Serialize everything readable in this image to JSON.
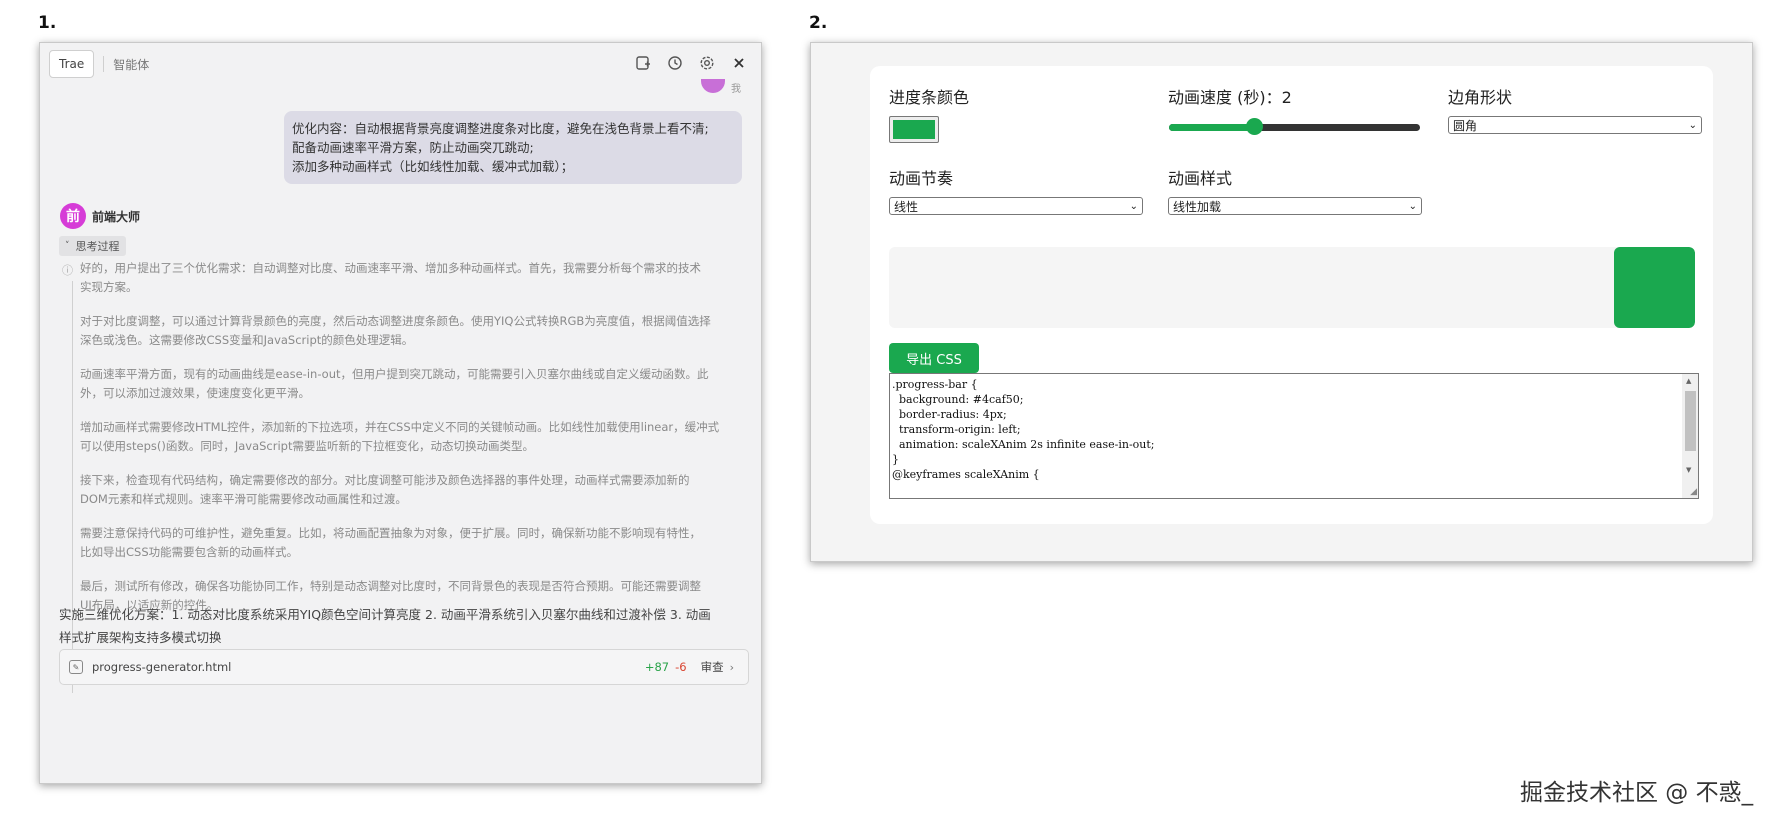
{
  "panel_numbers": {
    "left": "1.",
    "right": "2."
  },
  "left_panel": {
    "tabs": {
      "trae": "Trae",
      "agent": "智能体"
    },
    "user_peek_text": "我",
    "user_message": [
      "优化内容：自动根据背景亮度调整进度条对比度，避免在浅色背景上看不清;",
      "配备动画速率平滑方案，防止动画突兀跳动;",
      "添加多种动画样式（比如线性加载、缓冲式加载）；"
    ],
    "agent": {
      "avatar_char": "前",
      "name": "前端大师"
    },
    "thinking_toggle": "思考过程",
    "thinking_paragraphs": [
      [
        "好的，用户提出了三个优化需求：自动调整对比度、动画速率平滑、增加多种动画样式。首先，我需要分析每个需求的技术",
        "实现方案。"
      ],
      [
        "对于对比度调整，可以通过计算背景颜色的亮度，然后动态调整进度条颜色。使用YIQ公式转换RGB为亮度值，根据阈值选择",
        "深色或浅色。这需要修改CSS变量和JavaScript的颜色处理逻辑。"
      ],
      [
        "动画速率平滑方面，现有的动画曲线是ease-in-out，但用户提到突兀跳动，可能需要引入贝塞尔曲线或自定义缓动函数。此",
        "外，可以添加过渡效果，使速度变化更平滑。"
      ],
      [
        "增加动画样式需要修改HTML控件，添加新的下拉选项，并在CSS中定义不同的关键帧动画。比如线性加载使用linear，缓冲式",
        "可以使用steps()函数。同时，JavaScript需要监听新的下拉框变化，动态切换动画类型。"
      ],
      [
        "接下来，检查现有代码结构，确定需要修改的部分。对比度调整可能涉及颜色选择器的事件处理，动画样式需要添加新的",
        "DOM元素和样式规则。速率平滑可能需要修改动画属性和过渡。"
      ],
      [
        "需要注意保持代码的可维护性，避免重复。比如，将动画配置抽象为对象，便于扩展。同时，确保新功能不影响现有特性，",
        "比如导出CSS功能需要包含新的动画样式。"
      ],
      [
        "最后，测试所有修改，确保各功能协同工作，特别是动态调整对比度时，不同背景色的表现是否符合预期。可能还需要调整",
        "UI布局，以适应新的控件。"
      ]
    ],
    "summary": [
      "实施三维优化方案：1. 动态对比度系统采用YIQ颜色空间计算亮度 2. 动画平滑系统引入贝塞尔曲线和过渡补偿 3. 动画",
      "样式扩展架构支持多模式切换"
    ],
    "file": {
      "name": "progress-generator.html",
      "added": "+87",
      "removed": "-6",
      "review": "审查"
    }
  },
  "right_panel": {
    "labels": {
      "color": "进度条颜色",
      "speed": "动画速度 (秒)：2",
      "corner": "边角形状",
      "rhythm": "动画节奏",
      "style": "动画样式"
    },
    "selects": {
      "corner": "圆角",
      "rhythm": "线性",
      "style": "线性加载"
    },
    "slider_value_fraction": 0.34,
    "accent_color": "#1aa84f",
    "export_label": "导出 CSS",
    "code_lines": [
      ".progress-bar {",
      "  background: #4caf50;",
      "  border-radius: 4px;",
      "  transform-origin: left;",
      "  animation: scaleXAnim 2s infinite ease-in-out;",
      "}",
      "",
      "@keyframes scaleXAnim {"
    ],
    "preview_fill_fraction": 0.1
  },
  "watermark": "掘金技术社区 @ 不惑_"
}
